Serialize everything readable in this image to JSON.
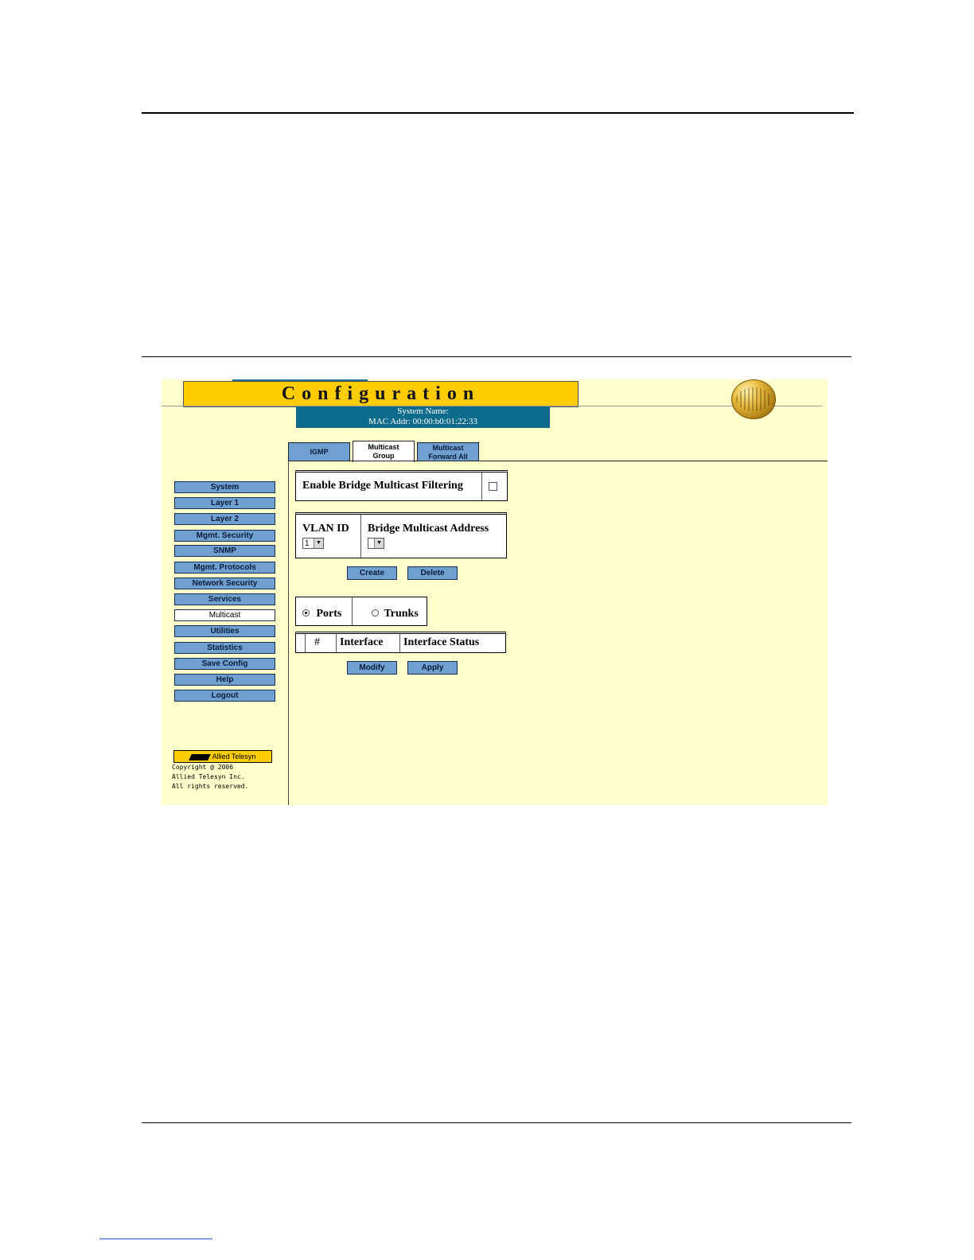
{
  "header": {
    "title": "Configuration",
    "system_name": "System Name:",
    "mac_addr": "MAC Addr:  00:00:b0:01:22:33"
  },
  "tabs": [
    {
      "label": "IGMP"
    },
    {
      "label": "Multicast Group"
    },
    {
      "label": "Multicast Forward All"
    }
  ],
  "sidebar": {
    "items": [
      {
        "label": "System"
      },
      {
        "label": "Layer 1"
      },
      {
        "label": "Layer 2"
      },
      {
        "label": "Mgmt. Security"
      },
      {
        "label": "SNMP"
      },
      {
        "label": "Mgmt. Protocols"
      },
      {
        "label": "Network Security"
      },
      {
        "label": "Services"
      },
      {
        "label": "Multicast"
      },
      {
        "label": "Utilities"
      },
      {
        "label": "Statistics"
      },
      {
        "label": "Save Config"
      },
      {
        "label": "Help"
      },
      {
        "label": "Logout"
      }
    ],
    "active": "Multicast",
    "logo_text": "Allied Telesyn",
    "copyright": [
      "Copyright @ 2006",
      "Allied Telesyn Inc.",
      "All rights reserved."
    ]
  },
  "main": {
    "filtering_label": "Enable Bridge Multicast Filtering",
    "vlan_id_label": "VLAN ID",
    "vlan_id_value": "1",
    "bridge_addr_label": "Bridge Multicast Address",
    "bridge_addr_value": "",
    "create_label": "Create",
    "delete_label": "Delete",
    "ports_label": "Ports",
    "trunks_label": "Trunks",
    "selected_radio": "Ports",
    "columns": [
      "#",
      "Interface",
      "Interface Status"
    ],
    "modify_label": "Modify",
    "apply_label": "Apply"
  },
  "colors": {
    "title_bar": "#ffcc00",
    "sys_box": "#0e6b8c",
    "button": "#6fa0cf",
    "panel_bg": "#ffffcc"
  }
}
